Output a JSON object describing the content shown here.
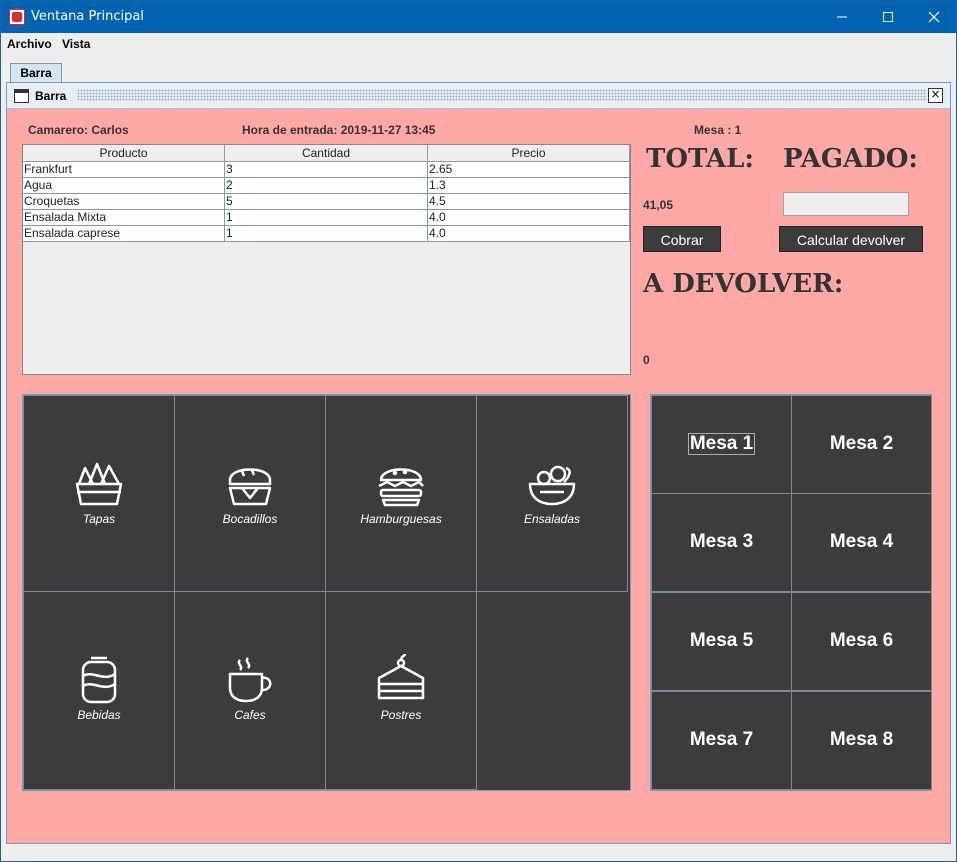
{
  "window": {
    "title": "Ventana Principal",
    "controls": [
      "minimize",
      "maximize",
      "close"
    ]
  },
  "menu": {
    "items": [
      "Archivo",
      "Vista"
    ]
  },
  "tabs": [
    "Barra"
  ],
  "frame": {
    "title": "Barra"
  },
  "info": {
    "camarero": "Camarero: Carlos",
    "hora": "Hora de entrada: 2019-11-27 13:45",
    "mesa": "Mesa : 1"
  },
  "order_table": {
    "headers": [
      "Producto",
      "Cantidad",
      "Precio"
    ],
    "rows": [
      [
        "Frankfurt",
        "3",
        "2.65"
      ],
      [
        "Agua",
        "2",
        "1.3"
      ],
      [
        "Croquetas",
        "5",
        "4.5"
      ],
      [
        "Ensalada Mixta",
        "1",
        "4.0"
      ],
      [
        "Ensalada caprese",
        "1",
        "4.0"
      ]
    ]
  },
  "payment": {
    "total_label": "TOTAL:",
    "pagado_label": "PAGADO:",
    "total_value": "41,05",
    "pagado_value": "",
    "cobrar_button": "Cobrar",
    "calcular_button": "Calcular devolver",
    "devolver_label": "A DEVOLVER:",
    "devolver_value": "0"
  },
  "categories": [
    {
      "label": "Tapas",
      "icon": "tapas-icon"
    },
    {
      "label": "Bocadillos",
      "icon": "sandwich-icon"
    },
    {
      "label": "Hamburguesas",
      "icon": "burger-icon"
    },
    {
      "label": "Ensaladas",
      "icon": "salad-icon"
    },
    {
      "label": "Bebidas",
      "icon": "drink-can-icon"
    },
    {
      "label": "Cafes",
      "icon": "coffee-cup-icon"
    },
    {
      "label": "Postres",
      "icon": "cake-icon"
    }
  ],
  "mesas": [
    "Mesa 1",
    "Mesa 2",
    "Mesa 3",
    "Mesa 4",
    "Mesa 5",
    "Mesa 6",
    "Mesa 7",
    "Mesa 8"
  ],
  "colors": {
    "background": "#ffa8a8",
    "tile": "#3c3c3c",
    "titlebar": "#0063b1"
  }
}
